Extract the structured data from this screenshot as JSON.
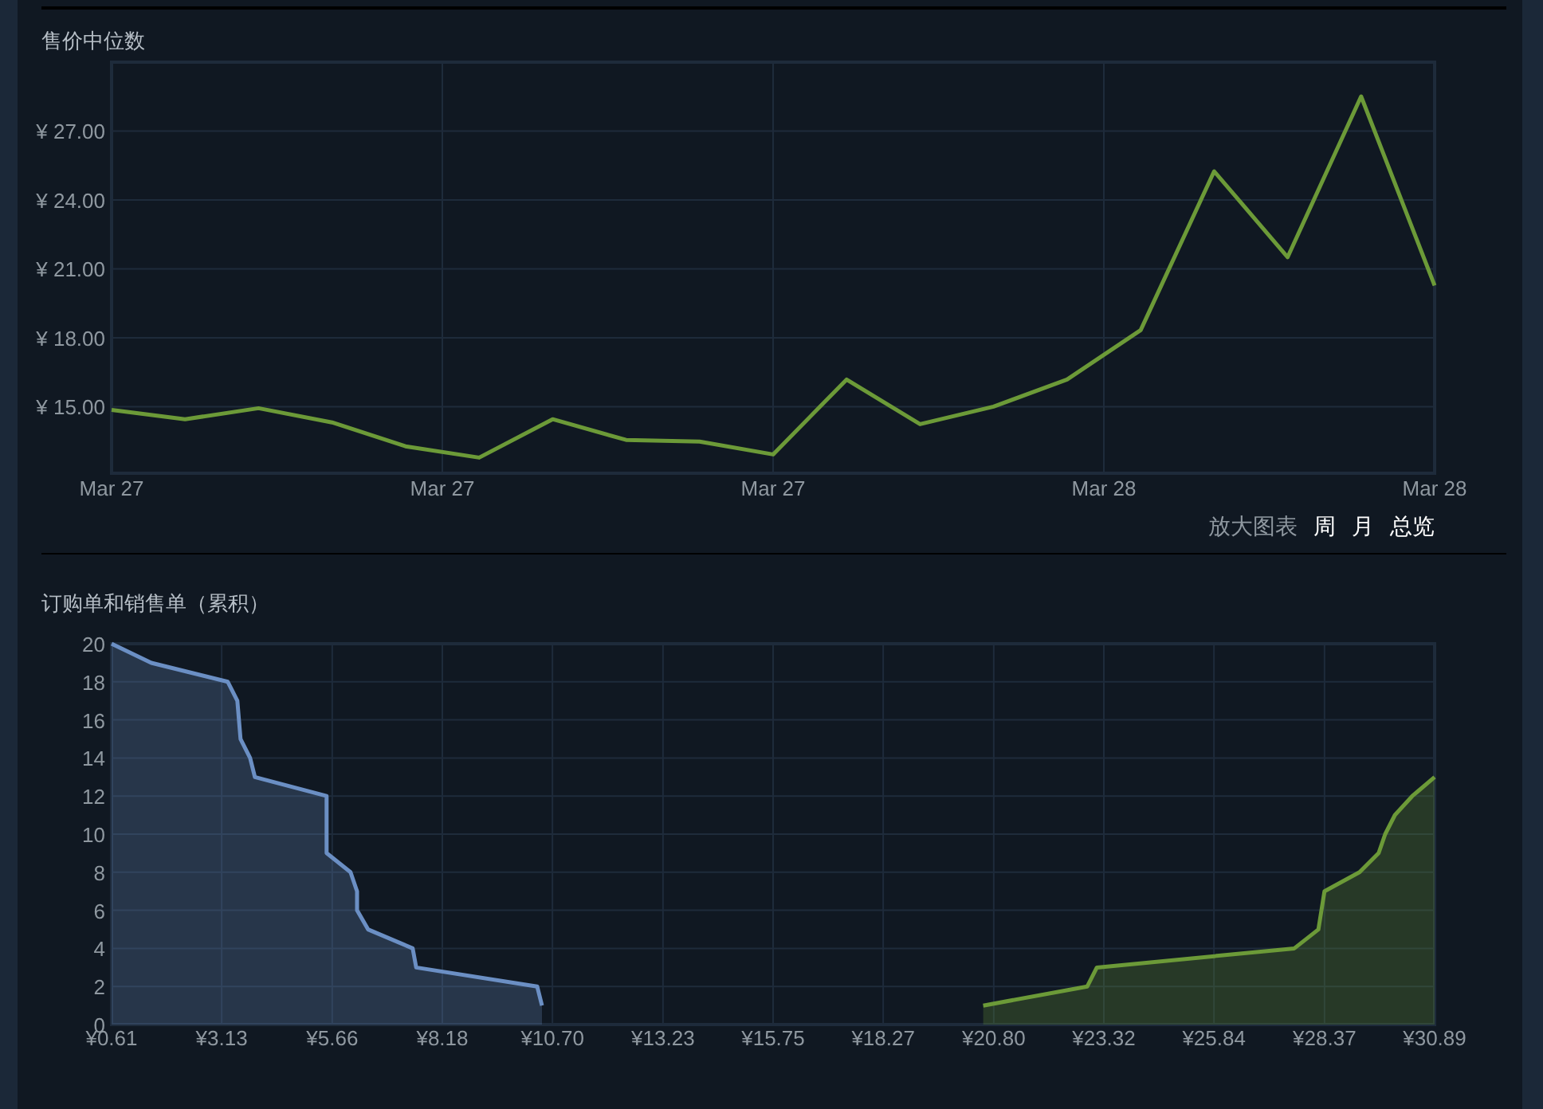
{
  "price_history": {
    "title": "售价中位数",
    "chart_data": {
      "type": "line",
      "categories": [
        "Mar 27",
        null,
        null,
        null,
        null,
        null,
        null,
        null,
        null,
        "Mar 27",
        null,
        null,
        null,
        null,
        null,
        null,
        null,
        null,
        "Mar 27",
        null,
        null,
        null,
        null,
        null,
        null,
        null,
        null,
        "Mar 28",
        null,
        null,
        null,
        null,
        null,
        null,
        null,
        null,
        "Mar 28"
      ],
      "series": [
        {
          "color": "#6c9a38",
          "values": [
            14.86,
            null,
            14.45,
            null,
            14.93,
            null,
            14.31,
            null,
            13.27,
            null,
            12.78,
            null,
            14.45,
            null,
            13.55,
            null,
            13.48,
            null,
            12.92,
            null,
            16.18,
            null,
            14.24,
            null,
            15.0,
            null,
            16.18,
            null,
            18.33,
            null,
            25.25,
            null,
            21.51,
            null,
            28.51,
            null,
            20.27
          ]
        }
      ],
      "ylim": [
        12.1,
        30
      ],
      "grid": true,
      "yticks": [
        {
          "value": 15,
          "label": "¥ 15.00"
        },
        {
          "value": 18,
          "label": "¥ 18.00"
        },
        {
          "value": 21,
          "label": "¥ 21.00"
        },
        {
          "value": 24,
          "label": "¥ 24.00"
        },
        {
          "value": 27,
          "label": "¥ 27.00"
        }
      ]
    },
    "zoom_label": "放大图表",
    "zoom_options": [
      "周",
      "月",
      "总览"
    ]
  },
  "order_book": {
    "title": "订购单和销售单（累积）",
    "chart_data": {
      "type": "area",
      "series": [
        {
          "color": "#6b8fc4",
          "x": [
            0.61,
            1.52,
            3.27,
            3.49,
            3.56,
            3.78,
            3.89,
            5.53,
            5.53,
            6.08,
            6.23,
            6.23,
            6.48,
            7.5,
            7.58,
            10.35,
            10.46
          ],
          "values": [
            20,
            19,
            18,
            17,
            15,
            14,
            13,
            12,
            9,
            8,
            7,
            6,
            5,
            4,
            3,
            2,
            1
          ]
        },
        {
          "color": "#6c9a38",
          "x": [
            20.56,
            22.94,
            23.16,
            27.68,
            28.23,
            28.37,
            29.17,
            29.61,
            29.76,
            29.98,
            30.38,
            30.89
          ],
          "values": [
            1,
            2,
            3,
            4,
            5,
            7,
            8,
            9,
            10,
            11,
            12,
            13
          ]
        }
      ],
      "xlim": [
        0.61,
        30.89
      ],
      "ylim": [
        0,
        20
      ],
      "grid": true,
      "xticks": [
        {
          "value": 0.61,
          "label": "¥0.61"
        },
        {
          "value": 3.13,
          "label": "¥3.13"
        },
        {
          "value": 5.66,
          "label": "¥5.66"
        },
        {
          "value": 8.18,
          "label": "¥8.18"
        },
        {
          "value": 10.7,
          "label": "¥10.70"
        },
        {
          "value": 13.23,
          "label": "¥13.23"
        },
        {
          "value": 15.75,
          "label": "¥15.75"
        },
        {
          "value": 18.27,
          "label": "¥18.27"
        },
        {
          "value": 20.8,
          "label": "¥20.80"
        },
        {
          "value": 23.32,
          "label": "¥23.32"
        },
        {
          "value": 25.84,
          "label": "¥25.84"
        },
        {
          "value": 28.37,
          "label": "¥28.37"
        },
        {
          "value": 30.89,
          "label": "¥30.89"
        }
      ],
      "yticks": [
        0,
        2,
        4,
        6,
        8,
        10,
        12,
        14,
        16,
        18,
        20
      ]
    }
  }
}
